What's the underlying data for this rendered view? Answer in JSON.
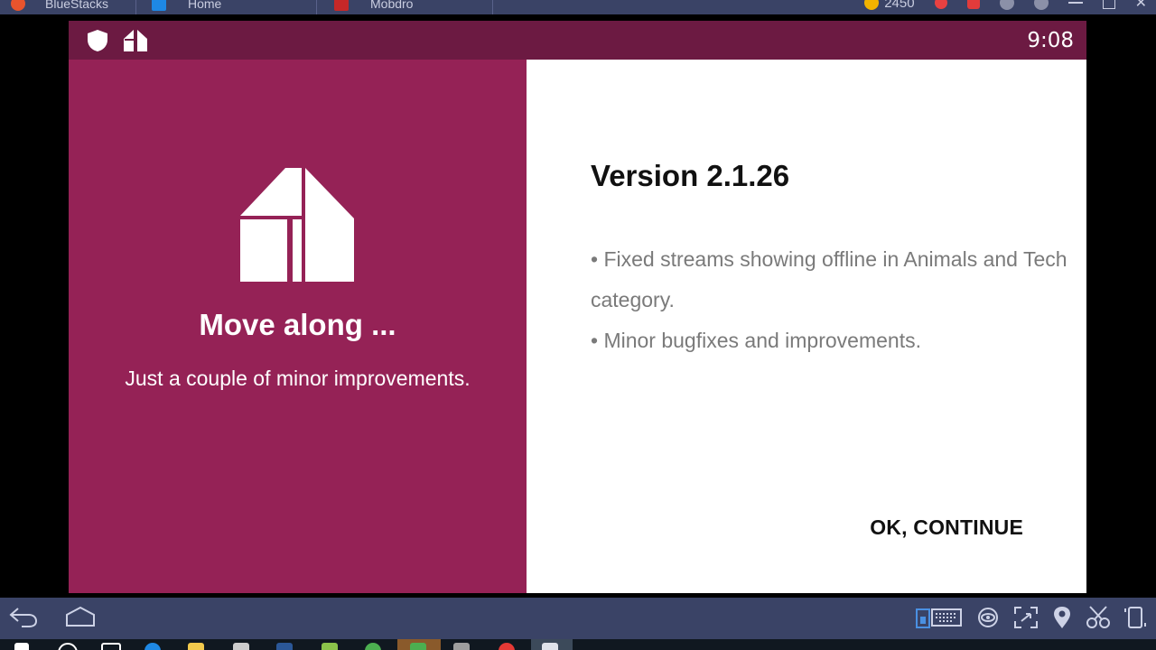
{
  "emulator": {
    "tabs": [
      {
        "label": "BlueStacks",
        "color": "#e8542d"
      },
      {
        "label": "Home",
        "color": "#1e88e5"
      },
      {
        "label": "Mobdro",
        "color": "#c62828"
      }
    ],
    "coins": "2450"
  },
  "status_bar": {
    "time": "9:08",
    "icons": [
      "shield-icon",
      "mobdro-logo-icon"
    ],
    "color": "#6c1a42"
  },
  "left_panel": {
    "title": "Move along ...",
    "subtitle": "Just a couple of minor improvements.",
    "color": "#952256"
  },
  "right_panel": {
    "version": "Version 2.1.26",
    "notes": [
      "• Fixed streams showing offline in Animals and Tech category.",
      "• Minor bugfixes and improvements."
    ],
    "continue_label": "OK, CONTINUE"
  },
  "bottom_bar": {
    "left_icons": [
      "back-icon",
      "home-icon"
    ],
    "right_icons": [
      "keyboard-icon",
      "eye-icon",
      "fullscreen-icon",
      "location-icon",
      "scissors-icon",
      "phone-rotate-icon"
    ]
  }
}
